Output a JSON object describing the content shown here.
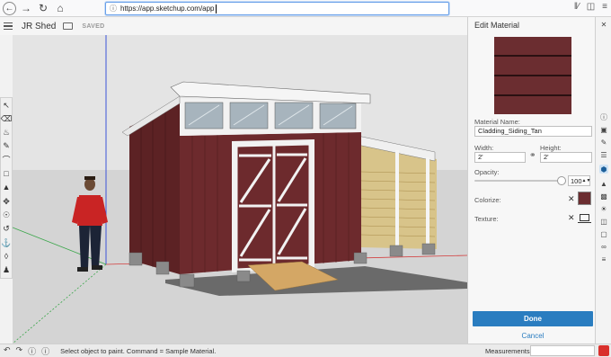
{
  "browser": {
    "url": "https://app.sketchup.com/app",
    "icons": [
      "back-icon",
      "forward-icon",
      "reload-icon",
      "home-icon",
      "library-icon",
      "sidebar-icon",
      "menu-icon"
    ]
  },
  "app": {
    "project_title": "JR Shed",
    "saved_label": "SAVED"
  },
  "left_toolbar": {
    "tools": [
      "select",
      "eraser",
      "paint-bucket",
      "pencil",
      "arc",
      "rectangle",
      "push-pull",
      "move",
      "tape-measure",
      "orbit",
      "walk",
      "section-plane",
      "position-camera"
    ]
  },
  "panel": {
    "title": "Edit Material",
    "material_name_label": "Material Name:",
    "material_name_value": "Cladding_Siding_Tan",
    "width_label": "Width:",
    "width_value": "2'",
    "height_label": "Height:",
    "height_value": "2'",
    "opacity_label": "Opacity:",
    "opacity_value": "100",
    "opacity_level": 1.0,
    "colorize_label": "Colorize:",
    "texture_label": "Texture:",
    "material_color": "#6b2d30",
    "done_label": "Done",
    "cancel_label": "Cancel"
  },
  "status": {
    "message": "Select object to paint. Command = Sample Material.",
    "measurements_label": "Measurements",
    "measurements_value": ""
  },
  "colors": {
    "accent": "#2a7dc0",
    "shed_siding": "#6d2a2d",
    "trim": "#f2f2f2",
    "ground": "#d9d9d9"
  }
}
